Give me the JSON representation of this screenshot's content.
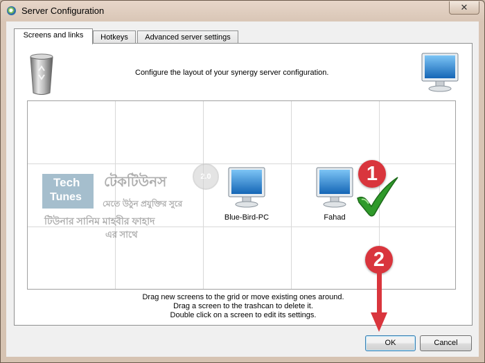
{
  "window": {
    "title": "Server Configuration",
    "close_symbol": "✕"
  },
  "tabs": [
    {
      "label": "Screens and links",
      "active": true
    },
    {
      "label": "Hotkeys",
      "active": false
    },
    {
      "label": "Advanced server settings",
      "active": false
    }
  ],
  "panel": {
    "header_text": "Configure the layout of your synergy server configuration.",
    "screens": [
      {
        "name": "Blue-Bird-PC",
        "column": 3,
        "row": 2
      },
      {
        "name": "Fahad",
        "column": 4,
        "row": 2
      }
    ],
    "instructions": [
      "Drag new screens to the grid or move existing ones around.",
      "Drag a screen to the trashcan to delete it.",
      "Double click on a screen to edit its settings."
    ]
  },
  "watermark": {
    "logo_line1": "Tech",
    "logo_line2": "Tunes",
    "version_badge": "2.0",
    "line1": "টেকটিউনস",
    "line2": "মেতে উঠুন প্রযুক্তির সুরে",
    "line3": "টিউনার সানিম মাহবীর ফাহাদ",
    "line4": "এর সাথে"
  },
  "annotations": {
    "badge1": "1",
    "badge2": "2"
  },
  "buttons": {
    "ok_label": "OK",
    "cancel_label": "Cancel"
  },
  "colors": {
    "annotation_red": "#d9353d",
    "checkmark_green": "#2f9a2a",
    "monitor_blue": "#1e7fd0"
  }
}
